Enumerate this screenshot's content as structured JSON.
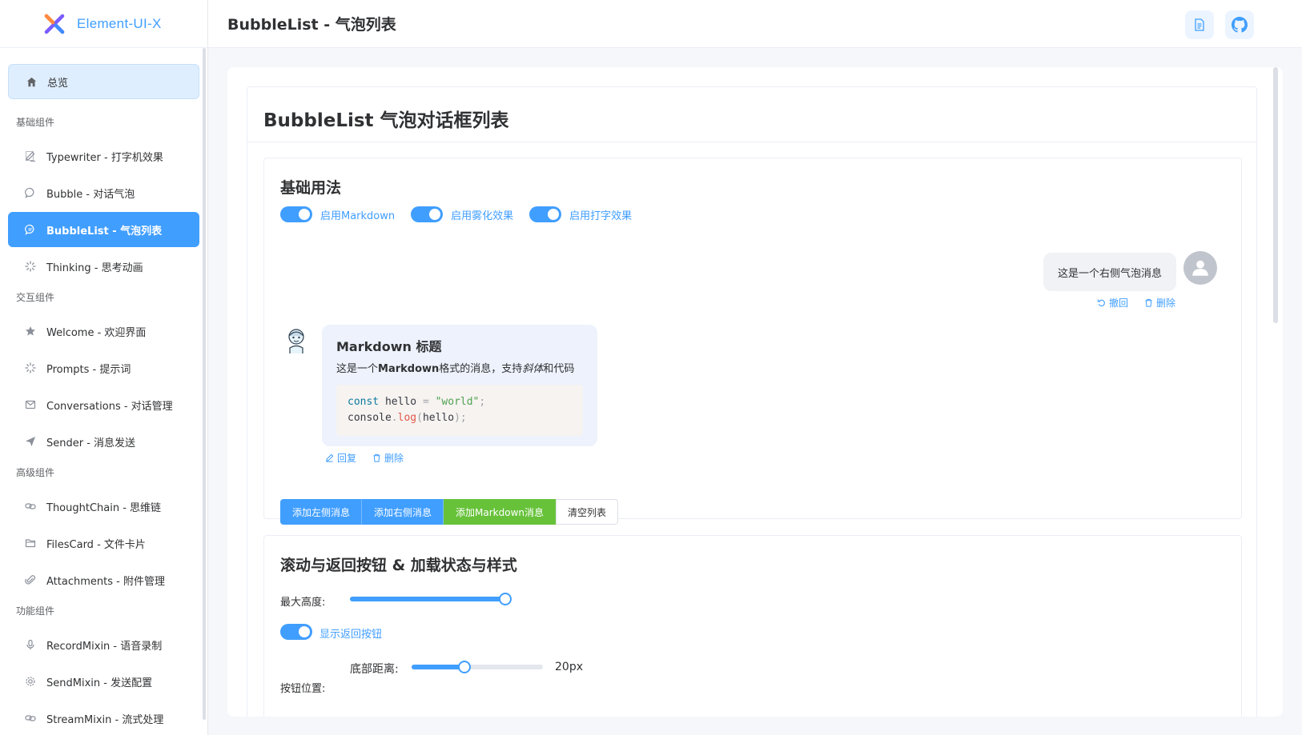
{
  "app": {
    "logo_text": "Element-UI-X"
  },
  "header": {
    "title": "BubbleList - 气泡列表"
  },
  "sidebar": {
    "overview": "总览",
    "groups": [
      {
        "title": "基础组件",
        "items": [
          {
            "label": "Typewriter - 打字机效果",
            "icon": "edit-icon"
          },
          {
            "label": "Bubble - 对话气泡",
            "icon": "chat-icon"
          },
          {
            "label": "BubbleList - 气泡列表",
            "icon": "chat-dots-icon",
            "active": true
          },
          {
            "label": "Thinking - 思考动画",
            "icon": "loading-icon"
          }
        ]
      },
      {
        "title": "交互组件",
        "items": [
          {
            "label": "Welcome - 欢迎界面",
            "icon": "star-icon"
          },
          {
            "label": "Prompts - 提示词",
            "icon": "loading-icon"
          },
          {
            "label": "Conversations - 对话管理",
            "icon": "message-icon"
          },
          {
            "label": "Sender - 消息发送",
            "icon": "send-icon"
          }
        ]
      },
      {
        "title": "高级组件",
        "items": [
          {
            "label": "ThoughtChain - 思维链",
            "icon": "link-icon"
          },
          {
            "label": "FilesCard - 文件卡片",
            "icon": "folder-icon"
          },
          {
            "label": "Attachments - 附件管理",
            "icon": "paperclip-icon"
          }
        ]
      },
      {
        "title": "功能组件",
        "items": [
          {
            "label": "RecordMixin - 语音录制",
            "icon": "microphone-icon"
          },
          {
            "label": "SendMixin - 发送配置",
            "icon": "gear-icon"
          },
          {
            "label": "StreamMixin - 流式处理",
            "icon": "link-icon"
          }
        ]
      }
    ]
  },
  "page": {
    "title": "BubbleList 气泡对话框列表",
    "basic": {
      "title": "基础用法",
      "switches": [
        {
          "label": "启用Markdown",
          "on": true
        },
        {
          "label": "启用雾化效果",
          "on": true
        },
        {
          "label": "启用打字效果",
          "on": true
        }
      ],
      "right_bubble": {
        "text": "这是一个右侧气泡消息",
        "actions": [
          "撤回",
          "删除"
        ]
      },
      "left_bubble": {
        "heading": "Markdown 标题",
        "p_prefix": "这是一个",
        "p_bold": "Markdown",
        "p_mid": "格式的消息，支持",
        "p_italic": "斜体",
        "p_suffix": "和代码",
        "code_line1": {
          "kw": "const",
          "name": " hello ",
          "op": "=",
          "str": " \"world\"",
          "end": ";"
        },
        "code_line2": {
          "obj": "console",
          "dot": ".",
          "fn": "log",
          "open": "(",
          "arg": "hello",
          "close": ");"
        },
        "actions": [
          "回复",
          "删除"
        ]
      },
      "buttons": [
        "添加左侧消息",
        "添加右侧消息",
        "添加Markdown消息",
        "清空列表"
      ]
    },
    "scroll": {
      "title": "滚动与返回按钮 & 加载状态与样式",
      "max_height_label": "最大高度:",
      "max_height_fraction": 1.0,
      "back_button_label": "显示返回按钮",
      "bottom_distance_label": "底部距离:",
      "bottom_distance_value": "20px",
      "bottom_distance_fraction": 0.4,
      "button_position_label": "按钮位置:"
    }
  },
  "colors": {
    "primary": "#409eff",
    "success": "#67c23a"
  }
}
